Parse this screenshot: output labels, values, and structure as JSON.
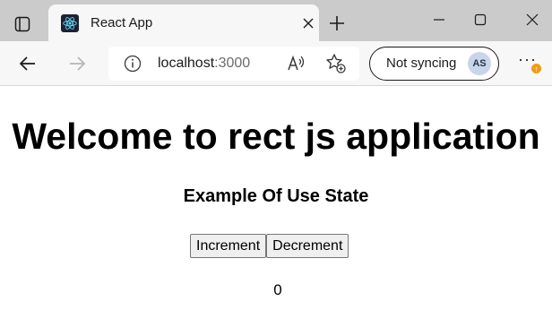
{
  "tab": {
    "title": "React App"
  },
  "address_bar": {
    "host": "localhost",
    "port": ":3000"
  },
  "profile": {
    "sync_label": "Not syncing",
    "initials": "AS",
    "update_badge": "↑"
  },
  "page": {
    "heading": "Welcome to rect js application",
    "subheading": "Example Of Use State",
    "increment_label": "Increment",
    "decrement_label": "Decrement",
    "count": "0"
  },
  "icons": {
    "tab_actions": "tab-actions-icon",
    "favicon": "react-logo-icon",
    "close": "close-icon",
    "new_tab": "plus-icon",
    "minimize": "minimize-icon",
    "maximize": "maximize-icon",
    "window_close": "close-icon",
    "back": "arrow-left-icon",
    "forward": "arrow-right-icon",
    "site_info": "info-icon",
    "read_aloud": "read-aloud-icon",
    "favorites": "favorites-add-icon",
    "more": "more-icon"
  },
  "colors": {
    "react_logo": "#61dafb",
    "update_badge": "#f29b12",
    "avatar_bg": "#c9d5ea"
  }
}
